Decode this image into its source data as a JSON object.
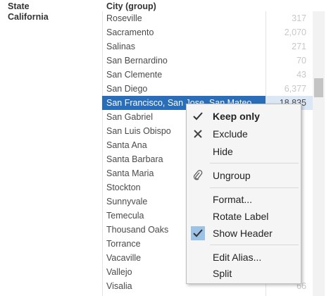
{
  "headers": {
    "state": "State",
    "city": "City (group)"
  },
  "state": "California",
  "rows": [
    {
      "city": "Roseville",
      "value": "317"
    },
    {
      "city": "Sacramento",
      "value": "2,070"
    },
    {
      "city": "Salinas",
      "value": "271"
    },
    {
      "city": "San Bernardino",
      "value": "70"
    },
    {
      "city": "San Clemente",
      "value": "43"
    },
    {
      "city": "San Diego",
      "value": "6,377"
    },
    {
      "city": "San Francisco, San Jose, San Mateo",
      "value": "18,835"
    },
    {
      "city": "San Gabriel",
      "value": ""
    },
    {
      "city": "San Luis Obispo",
      "value": ""
    },
    {
      "city": "Santa Ana",
      "value": ""
    },
    {
      "city": "Santa Barbara",
      "value": ""
    },
    {
      "city": "Santa Maria",
      "value": ""
    },
    {
      "city": "Stockton",
      "value": ""
    },
    {
      "city": "Sunnyvale",
      "value": ""
    },
    {
      "city": "Temecula",
      "value": ""
    },
    {
      "city": "Thousand Oaks",
      "value": ""
    },
    {
      "city": "Torrance",
      "value": ""
    },
    {
      "city": "Vacaville",
      "value": ""
    },
    {
      "city": "Vallejo",
      "value": ""
    },
    {
      "city": "Visalia",
      "value": "66"
    }
  ],
  "selected_row_index": 6,
  "menu": {
    "keep_only": "Keep only",
    "exclude": "Exclude",
    "hide": "Hide",
    "ungroup": "Ungroup",
    "format": "Format...",
    "rotate_label": "Rotate Label",
    "show_header": "Show Header",
    "edit_alias": "Edit Alias...",
    "split": "Split"
  },
  "icons": {
    "keep_only": "checkmark-icon",
    "exclude": "x-icon",
    "ungroup": "paperclip-icon",
    "show_header": "checkmark-icon"
  },
  "colors": {
    "selection": "#2a6db8",
    "checked_bg": "#9cc3e6"
  }
}
